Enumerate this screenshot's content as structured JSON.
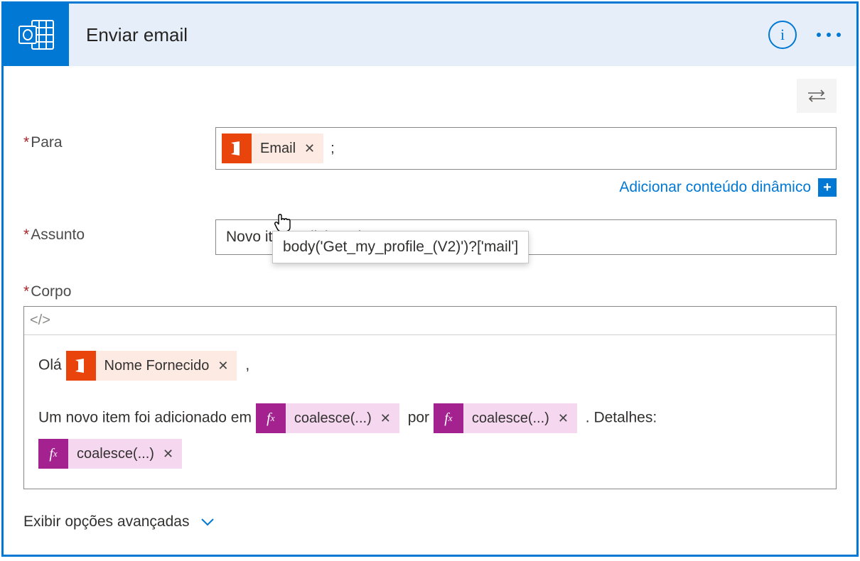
{
  "header": {
    "title": "Enviar email"
  },
  "fields": {
    "to_label": "Para",
    "subject_label": "Assunto",
    "body_label": "Corpo"
  },
  "to": {
    "token_label": "Email",
    "separator": ";",
    "tooltip": "body('Get_my_profile_(V2)')?['mail']"
  },
  "dynamic_link": "Adicionar conteúdo dinâmico",
  "subject_value": "Novo item adicionado",
  "body": {
    "greeting": "Olá",
    "name_token": "Nome Fornecido",
    "comma": ",",
    "line2_pre": "Um novo item foi adicionado em",
    "coalesce": "coalesce(...)",
    "por": "por",
    "detalhes": ". Detalhes:"
  },
  "advanced": "Exibir opções avançadas",
  "toolbar_code": "</>"
}
